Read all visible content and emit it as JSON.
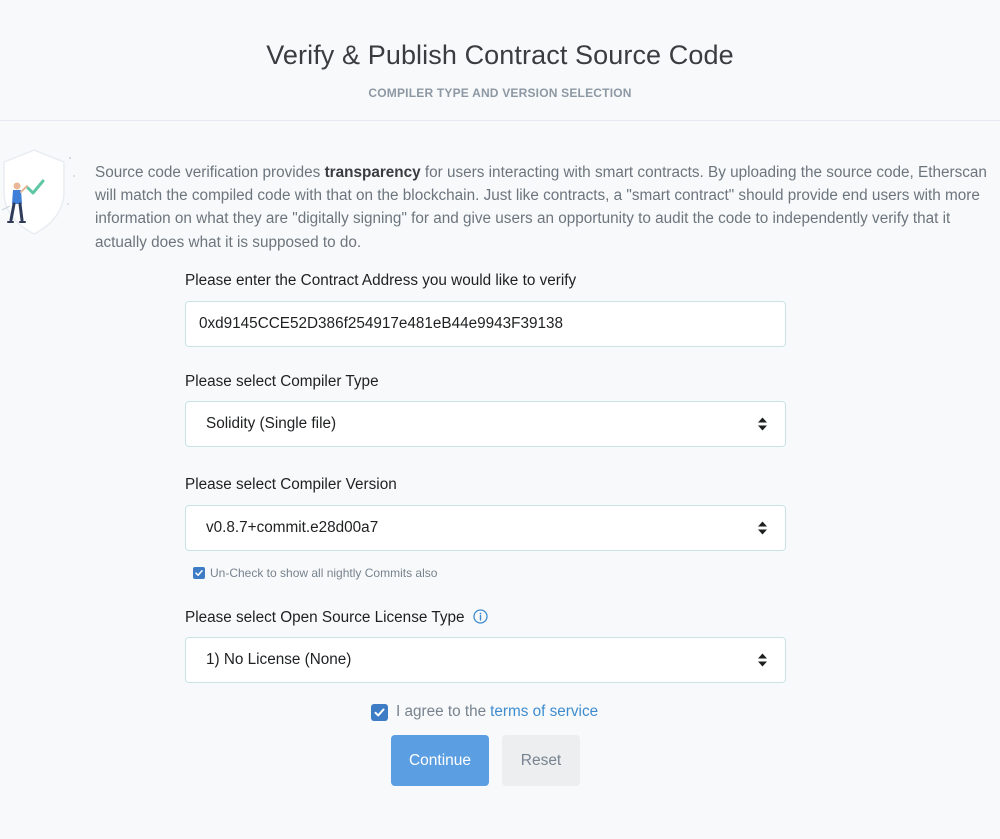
{
  "header": {
    "title": "Verify & Publish Contract Source Code",
    "subtitle": "COMPILER TYPE AND VERSION SELECTION"
  },
  "intro": {
    "before_bold": "Source code verification provides ",
    "bold": "transparency",
    "after_bold": " for users interacting with smart contracts. By uploading the source code, Etherscan will match the compiled code with that on the blockchain. Just like contracts, a \"smart contract\" should provide end users with more information on what they are \"digitally signing\" for and give users an opportunity to audit the code to independently verify that it actually does what it is supposed to do."
  },
  "form": {
    "address_label": "Please enter the Contract Address you would like to verify",
    "address_value": "0xd9145CCE52D386f254917e481eB44e9943F39138",
    "compiler_type_label": "Please select Compiler Type",
    "compiler_type_value": "Solidity (Single file)",
    "compiler_version_label": "Please select Compiler Version",
    "compiler_version_value": "v0.8.7+commit.e28d00a7",
    "nightly_label": "Un-Check to show all nightly Commits also",
    "nightly_checked": true,
    "license_label": "Please select Open Source License Type",
    "license_value": "1) No License (None)",
    "agree_prefix": "I agree to the",
    "agree_link": "terms of service",
    "agree_checked": true,
    "continue_label": "Continue",
    "reset_label": "Reset"
  },
  "icons": {
    "select": "up-down-arrows-icon",
    "info": "info-circle-icon",
    "check": "checkmark-icon",
    "illustration": "verification-shield-illustration"
  },
  "colors": {
    "accent": "#3e7dc6",
    "primary_button": "#5b9ee1",
    "link": "#3e8ccf",
    "field_border": "#c9e3e4",
    "background": "#f8f9fa"
  }
}
